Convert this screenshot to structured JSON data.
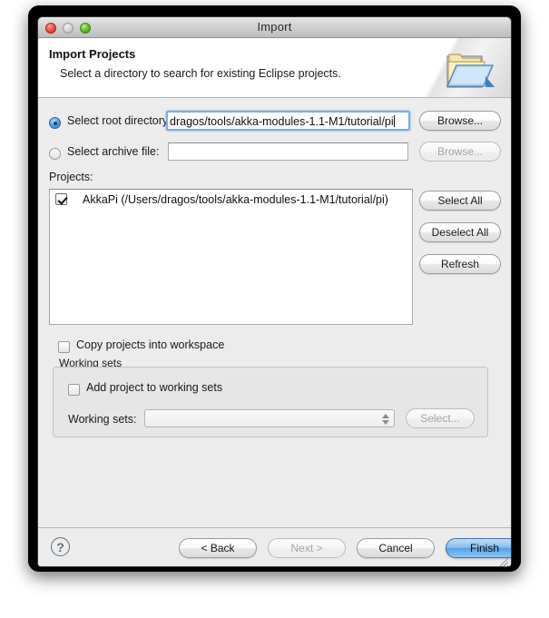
{
  "window": {
    "title": "Import",
    "traffic_lights": {
      "close": "close-button",
      "minimize": "minimize-button",
      "zoom": "zoom-button"
    }
  },
  "header": {
    "title": "Import Projects",
    "subtitle": "Select a directory to search for existing Eclipse projects.",
    "icon": "import-folder-icon"
  },
  "source": {
    "root_directory": {
      "label": "Select root directory:",
      "selected": true,
      "value": "dragos/tools/akka-modules-1.1-M1/tutorial/pi",
      "browse_label": "Browse...",
      "browse_enabled": true
    },
    "archive_file": {
      "label": "Select archive file:",
      "selected": false,
      "value": "",
      "placeholder": "",
      "browse_label": "Browse...",
      "browse_enabled": false
    }
  },
  "projects": {
    "label": "Projects:",
    "rows": [
      {
        "checked": true,
        "label": "AkkaPi (/Users/dragos/tools/akka-modules-1.1-M1/tutorial/pi)"
      }
    ],
    "buttons": {
      "select_all": "Select All",
      "deselect_all": "Deselect All",
      "refresh": "Refresh"
    }
  },
  "options": {
    "copy_projects": {
      "label": "Copy projects into workspace",
      "checked": false
    },
    "working_sets": {
      "group_label": "Working sets",
      "add_to_working_sets": {
        "label": "Add project to working sets",
        "checked": false
      },
      "combo_label": "Working sets:",
      "combo_value": "",
      "select_label": "Select...",
      "select_enabled": false
    }
  },
  "footer": {
    "help": "?",
    "back": "< Back",
    "next": "Next >",
    "next_enabled": false,
    "cancel": "Cancel",
    "finish": "Finish"
  },
  "colors": {
    "accent": "#56a2e4",
    "focus_ring": "#7aaede",
    "window_bg": "#ececec",
    "close_red": "#f0564a",
    "zoom_green": "#66c12f"
  }
}
